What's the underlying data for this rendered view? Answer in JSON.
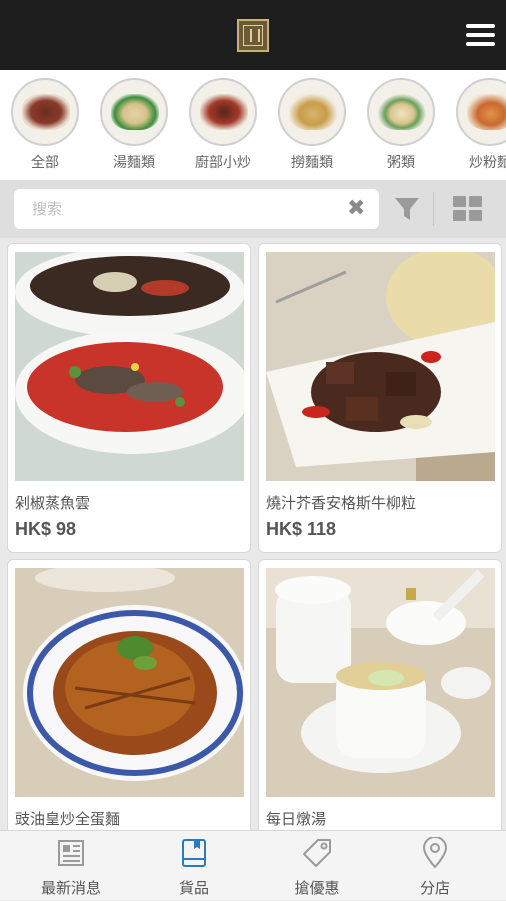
{
  "header": {
    "logo_icon": "restaurant-logo-icon",
    "menu_icon": "hamburger-menu-icon"
  },
  "categories": [
    {
      "label": "全部"
    },
    {
      "label": "湯麵類"
    },
    {
      "label": "廚部小炒"
    },
    {
      "label": "撈麵類"
    },
    {
      "label": "粥類"
    },
    {
      "label": "炒粉麵"
    }
  ],
  "search": {
    "placeholder": "搜索",
    "value": "",
    "clear_icon": "close-icon",
    "filter_icon": "filter-icon",
    "view_icon": "grid-view-icon"
  },
  "products": [
    {
      "name": "剁椒蒸魚雲",
      "price": "HK$ 98"
    },
    {
      "name": "燒汁芥香安格斯牛柳粒",
      "price": "HK$ 118"
    },
    {
      "name": "豉油皇炒全蛋麵",
      "price": ""
    },
    {
      "name": "每日燉湯",
      "price": ""
    }
  ],
  "bottom_nav": [
    {
      "label": "最新消息",
      "icon": "news-icon",
      "active": false
    },
    {
      "label": "貨品",
      "icon": "book-icon",
      "active": true
    },
    {
      "label": "搶優惠",
      "icon": "tag-icon",
      "active": false
    },
    {
      "label": "分店",
      "icon": "location-pin-icon",
      "active": false
    }
  ],
  "colors": {
    "header_bg": "#1e1e1e",
    "active_icon": "#2a7bbd",
    "logo_gold": "#c9b27a"
  }
}
